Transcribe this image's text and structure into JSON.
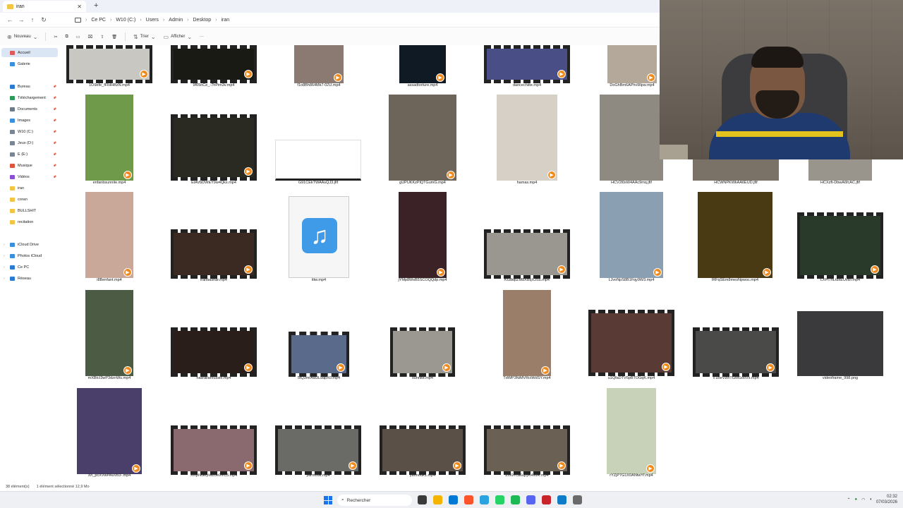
{
  "window": {
    "tab_title": "iran",
    "tab_close": "✕",
    "new_tab": "+"
  },
  "address": {
    "crumbs": [
      "Ce PC",
      "W10 (C:)",
      "Users",
      "Admin",
      "Desktop",
      "iran"
    ],
    "separator": "›"
  },
  "commands": {
    "new": "Nouveau",
    "sort": "Trier",
    "view": "Afficher",
    "more": "···"
  },
  "sidebar": {
    "items": [
      {
        "label": "Accueil",
        "color": "#e05a5a",
        "active": true,
        "pin": false,
        "chev": false
      },
      {
        "label": "Galerie",
        "color": "#3a8fe0",
        "active": false,
        "pin": false,
        "chev": false
      },
      {
        "label": "Bureau",
        "color": "#2b7bd6",
        "active": false,
        "pin": true,
        "chev": false
      },
      {
        "label": "Téléchargement",
        "color": "#2e9a5a",
        "active": false,
        "pin": true,
        "chev": false
      },
      {
        "label": "Documents",
        "color": "#6c7a89",
        "active": false,
        "pin": true,
        "chev": false
      },
      {
        "label": "Images",
        "color": "#3a8fe0",
        "active": false,
        "pin": true,
        "chev": false
      },
      {
        "label": "W10 (C:)",
        "color": "#7a8594",
        "active": false,
        "pin": true,
        "chev": false
      },
      {
        "label": "Jeux (D:)",
        "color": "#7a8594",
        "active": false,
        "pin": true,
        "chev": false
      },
      {
        "label": "E (E:)",
        "color": "#7a8594",
        "active": false,
        "pin": true,
        "chev": false
      },
      {
        "label": "Musique",
        "color": "#e0553a",
        "active": false,
        "pin": true,
        "chev": false
      },
      {
        "label": "Vidéos",
        "color": "#8a4fd6",
        "active": false,
        "pin": true,
        "chev": false
      },
      {
        "label": "iran",
        "color": "#f4c543",
        "active": false,
        "pin": false,
        "chev": false
      },
      {
        "label": "coran",
        "color": "#f4c543",
        "active": false,
        "pin": false,
        "chev": false
      },
      {
        "label": "BULLSHIT",
        "color": "#f4c543",
        "active": false,
        "pin": false,
        "chev": false
      },
      {
        "label": "recitation",
        "color": "#f4c543",
        "active": false,
        "pin": false,
        "chev": false
      },
      {
        "label": "iCloud Drive",
        "color": "#3a8fe0",
        "active": false,
        "pin": false,
        "chev": true
      },
      {
        "label": "Photos iCloud",
        "color": "#3a8fe0",
        "active": false,
        "pin": false,
        "chev": true
      },
      {
        "label": "Ce PC",
        "color": "#2b7bd6",
        "active": false,
        "pin": false,
        "chev": true
      },
      {
        "label": "Réseau",
        "color": "#2b7bd6",
        "active": false,
        "pin": false,
        "chev": true
      }
    ]
  },
  "files": [
    {
      "name": "1O9efe_fFlHHBzN.mp4",
      "kind": "reel",
      "bg": "#c9c7c1"
    },
    {
      "name": "9f05nCe_-7hPim3v.mp4",
      "kind": "reel",
      "bg": "#1a1a14"
    },
    {
      "name": "f1o8Bh864Mk7-02U.mp4",
      "kind": "plain",
      "bg": "#8a7a72"
    },
    {
      "name": "assadtorture.mp4",
      "kind": "plain",
      "bg": "#0f1a24"
    },
    {
      "name": "dancechiite.mp4",
      "kind": "reel",
      "bg": "#4a4e86"
    },
    {
      "name": "DoGhBm6APhv9llpw.mp4",
      "kind": "plain",
      "bg": "#b4a89a"
    },
    {
      "name": "enfanbsunnite.mp4",
      "kind": "plain",
      "bg": "#6f9a4a"
    },
    {
      "name": "EIAVbDWEY9w4Qks.mp4",
      "kind": "reel",
      "bg": "#2a2a22"
    },
    {
      "name": "G91CEkTWAAsQJ3.jfif",
      "kind": "doc",
      "bg": "#ffffff"
    },
    {
      "name": "gUPUKKzPlQTGumG.mp4",
      "kind": "plain",
      "bg": "#6e655a"
    },
    {
      "name": "hamas.mp4",
      "kind": "plain",
      "bg": "#d6d0c6"
    },
    {
      "name": "HCV2l0sW4AAc9mq.jfif",
      "kind": "plain",
      "bg": "#8e8a82"
    },
    {
      "name": "HCWNPKWkAA6EUD.jfif",
      "kind": "plain",
      "bg": "#7a7266"
    },
    {
      "name": "HCXzft-DbwA6fcAC.jfif",
      "kind": "plain",
      "bg": "#9a958c"
    },
    {
      "name": "i8Benfant.mp4",
      "kind": "plain",
      "bg": "#c9a89a"
    },
    {
      "name": "iranbashar.mp4",
      "kind": "reel",
      "bg": "#3a2a22"
    },
    {
      "name": "ittw.mp4",
      "kind": "media",
      "bg": "#f4f4f4"
    },
    {
      "name": "jYMp8WsB5SCOQQdp.mp4",
      "kind": "plain",
      "bg": "#3a2226"
    },
    {
      "name": "KGddpZM8XBqXJSu.mp4",
      "kind": "reel",
      "bg": "#9a9690"
    },
    {
      "name": "LJvoNpS8B1Fqy9W3.mp4",
      "kind": "plain",
      "bg": "#8aa0b2"
    },
    {
      "name": "lRFqSEm8mesNpwoc.mp4",
      "kind": "plain",
      "bg": "#4a3a14"
    },
    {
      "name": "LXPf7nLt8xEUvBf.mp4",
      "kind": "reel",
      "bg": "#2a3a2a"
    },
    {
      "name": "mXBtcI3wP3dznWu.mp4",
      "kind": "plain",
      "bg": "#4c5c44"
    },
    {
      "name": "nasrallahrussie.mp4",
      "kind": "reel",
      "bg": "#2a1e1a"
    },
    {
      "name": "5tQ3mrAw3L9apX0.mp4",
      "kind": "reel",
      "bg": "#5a6a8a"
    },
    {
      "name": "sunnite.mp4",
      "kind": "reel",
      "bg": "#9a9890"
    },
    {
      "name": "TdWP3NiMVRctWdSY.mp4",
      "kind": "plain",
      "bg": "#9a7e6a"
    },
    {
      "name": "u1QfaDTV6pBTOGqK.mp4",
      "kind": "reel",
      "bg": "#5a3a34"
    },
    {
      "name": "V1BeVzlhTGMGooVs.mp4",
      "kind": "reel",
      "bg": "#4a4a48"
    },
    {
      "name": "videoframe_998.png",
      "kind": "plain",
      "bg": "#3a3a3c"
    },
    {
      "name": "Xh_pcXVwPAuVb3-.mp4",
      "kind": "plain",
      "bg": "#4a3e6a"
    },
    {
      "name": "XmpNGeyIwZ0e9VC3.mp4",
      "kind": "reel",
      "bg": "#8a6a6e"
    },
    {
      "name": "yarmouk.mp4",
      "kind": "reel",
      "bg": "#6a6a66"
    },
    {
      "name": "yarmouk1.mp4",
      "kind": "reel",
      "bg": "#5a5048"
    },
    {
      "name": "Zm0rrca6upyK4vdR.mp4",
      "kind": "reel",
      "bg": "#6a6054"
    },
    {
      "name": "rYZjP7G1X0ANtwYf.mp4",
      "kind": "plain",
      "bg": "#c8d2b8"
    }
  ],
  "status": {
    "count": "38 élément(s)",
    "selection": "1 élément sélectionné  12,9 Mo"
  },
  "taskbar": {
    "search_placeholder": "Rechercher",
    "time": "02:32",
    "date": "07/03/2026",
    "apps": [
      {
        "name": "task-view",
        "color": "#3a3a3a"
      },
      {
        "name": "file-explorer",
        "color": "#f4b400"
      },
      {
        "name": "store",
        "color": "#0078d4"
      },
      {
        "name": "brave",
        "color": "#fb542b"
      },
      {
        "name": "telegram",
        "color": "#2aa3e0"
      },
      {
        "name": "whatsapp",
        "color": "#25d366"
      },
      {
        "name": "spotify",
        "color": "#1db954"
      },
      {
        "name": "discord",
        "color": "#5865f2"
      },
      {
        "name": "app",
        "color": "#c9242b"
      },
      {
        "name": "edge",
        "color": "#0f7cc9"
      },
      {
        "name": "settings",
        "color": "#6a6a6a"
      }
    ]
  },
  "colors": {
    "accent": "#0067c0",
    "video_badge": "#f08a1c"
  }
}
